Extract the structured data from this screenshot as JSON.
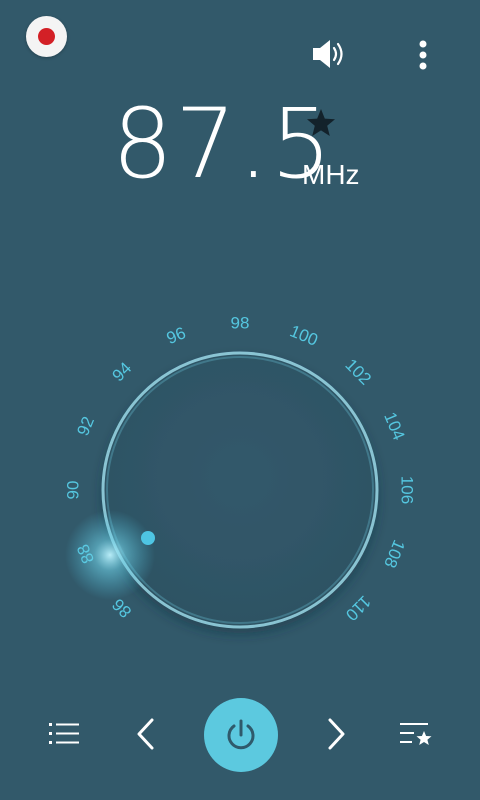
{
  "top_bar": {
    "record_icon": "record-icon",
    "volume_icon": "speaker-icon",
    "more_icon": "more-vert-icon"
  },
  "tuner": {
    "frequency": "87.5",
    "unit": "MHz",
    "favorite_icon": "star-icon",
    "favorite": true
  },
  "dial": {
    "ticks": [
      "86",
      "88",
      "90",
      "92",
      "94",
      "96",
      "98",
      "100",
      "102",
      "104",
      "106",
      "108",
      "110"
    ],
    "current_value": 87.5,
    "colors": {
      "tick_label": "#55c7e0",
      "ring": "#8fd4e4",
      "indicator": "#4ec5e3"
    }
  },
  "bottom_bar": {
    "list_icon": "station-list-icon",
    "prev_icon": "chevron-left-icon",
    "power_icon": "power-icon",
    "next_icon": "chevron-right-icon",
    "favorites_icon": "favorites-list-icon"
  },
  "colors": {
    "background": "#32596a",
    "accent": "#5cc9df",
    "record": "#d32026"
  }
}
